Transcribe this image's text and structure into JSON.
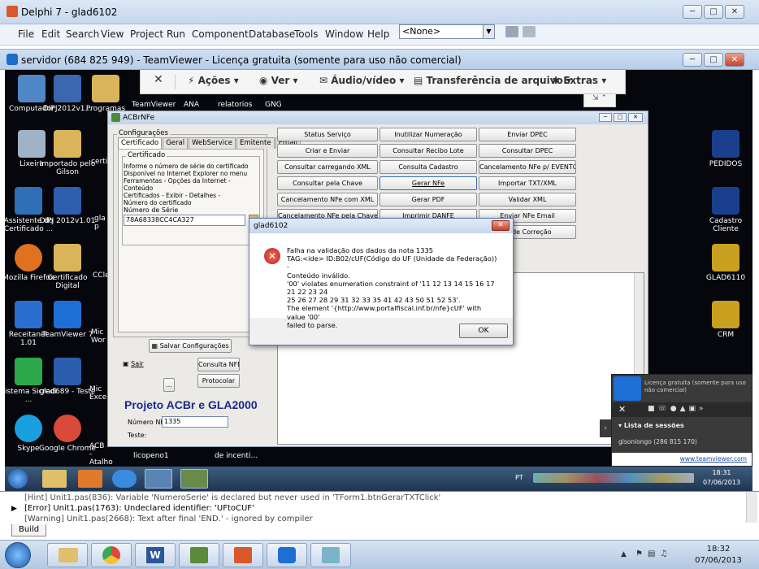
{
  "delphi": {
    "title": "Delphi 7 - glad6102",
    "menu": [
      "File",
      "Edit",
      "Search",
      "View",
      "Project",
      "Run",
      "Component",
      "Database",
      "Tools",
      "Window",
      "Help"
    ],
    "config_combo": "<None>"
  },
  "teamviewer": {
    "title": "servidor (684 825 949) - TeamViewer - Licença gratuita (somente para uso não comercial)",
    "toolbar": {
      "close_label": "✕",
      "acoes": "Ações",
      "ver": "Ver",
      "audio": "Áudio/vídeo",
      "transfer": "Transferência de arquivo",
      "extras": "Extras"
    },
    "panel": {
      "license": "Licença gratuita (somente para uso não comercial)",
      "sessions_header": "Lista de sessões",
      "session": "glsonlongo (286 815 170)",
      "link": "www.teamviewer.com"
    }
  },
  "desktop": {
    "left_icons": [
      {
        "label": "Computador",
        "color": "#4f86c6"
      },
      {
        "label": "Lixeira",
        "color": "#9fb3c8"
      },
      {
        "label": "Assistente do Certificado ...",
        "color": "#2f6fb5"
      },
      {
        "label": "Mozilla Firefox",
        "color": "#e0711f"
      },
      {
        "label": "Receitanet 1.01",
        "color": "#2a6fd0"
      },
      {
        "label": "Sistema Sicredi ...",
        "color": "#2aa84a"
      },
      {
        "label": "Skype",
        "color": "#1aa0e0"
      }
    ],
    "col2_icons": [
      {
        "label": "DIPJ2012v1...",
        "color": "#3b67b0"
      },
      {
        "label": "Importado pelo Gilson",
        "color": "#d9b45a"
      },
      {
        "label": "DIPJ 2012v1.01",
        "color": "#2d5fae"
      },
      {
        "label": "Certificado Digital",
        "color": "#d9b45a"
      },
      {
        "label": "TeamViewer 7",
        "color": "#1d6fd6"
      },
      {
        "label": "glad689 - Teste",
        "color": "#2b5dae"
      },
      {
        "label": "Google Chrome",
        "color": "#d94a3a"
      }
    ],
    "col3_labels": [
      "Programas",
      "certif",
      "gla p",
      "CCle",
      "Mic Wor",
      "Mic Excel",
      "ACB - Atalho"
    ],
    "top_row": [
      "TeamViewer",
      "ANA",
      "relatorios",
      "GNG"
    ],
    "bottom_row": [
      "licopeno1",
      "de incenti..."
    ],
    "right_icons": [
      {
        "label": "PEDIDOS",
        "color": "#1a3f8f"
      },
      {
        "label": "Cadastro Cliente",
        "color": "#1a3f8f"
      },
      {
        "label": "GLAD6110",
        "color": "#c9a020"
      },
      {
        "label": "CRM",
        "color": "#c9a020"
      }
    ]
  },
  "acbr": {
    "title": "ACBrNFe",
    "config_group": "Configurações",
    "tabs": [
      "Certificado",
      "Geral",
      "WebService",
      "Emitente",
      "Email"
    ],
    "cert_group": "Certificado",
    "cert_info": "Informe o número de série do certificado\nDisponível no Internet Explorer no menu\nFerramentas - Opções da Internet - Conteúdo\nCertificados - Exibir - Detalhes -\nNúmero do certificado",
    "serie_label": "Número de Série",
    "serie_value": "78A68338CC4CA327",
    "save_button": "Salvar Configurações",
    "sair_button": "Sair",
    "consulta_nfe": "Consulta NFE",
    "protocolar": "Protocolar",
    "ellipsis": "...",
    "project_title": "Projeto ACBr e GLA2000",
    "numero_label": "Número NF:",
    "numero_value": "1335",
    "teste_label": "Teste:",
    "buttons": [
      [
        "Status Serviço",
        "Inutilizar Numeração",
        "Enviar DPEC"
      ],
      [
        "Criar e Enviar",
        "Consultar Recibo Lote",
        "Consultar DPEC"
      ],
      [
        "Consultar carregando XML",
        "Consulta Cadastro",
        "Cancelamento NFe p/ EVENTO"
      ],
      [
        "Consultar pela Chave",
        "Gerar NFe",
        "Importar TXT/XML"
      ],
      [
        "Cancelamento NFe com XML",
        "Gerar PDF",
        "Validar XML"
      ],
      [
        "Cancelamento NFe pela Chave",
        "Imprimir DANFE",
        "Enviar NFe Email"
      ],
      [
        "",
        "",
        "ta de Correção"
      ]
    ]
  },
  "dialog": {
    "title": "glad6102",
    "message": "Falha na validação dos dados da nota 1335\nTAG:<ide> ID:B02/cUF(Código do UF (Unidade da Federação)) -\nConteúdo inválido.\n'00' violates enumeration constraint of '11 12 13 14 15 16 17 21 22 23 24\n25 26 27 28 29 31 32 33 35 41 42 43 50 51 52 53'.\nThe element '{http://www.portalfiscal.inf.br/nfe}cUF' with value '00'\nfailed to parse.",
    "ok": "OK"
  },
  "remote_taskbar": {
    "clock_time": "18:31",
    "clock_date": "07/06/2013",
    "lang": "PT"
  },
  "messages": {
    "lines": [
      "[Hint] Unit1.pas(836): Variable 'NumeroSerie' is declared but never used in 'TForm1.btnGerarTXTClick'",
      "[Error] Unit1.pas(1763): Undeclared identifier: 'UFtoCUF'",
      "[Warning] Unit1.pas(2668): Text after final 'END.' - ignored by compiler"
    ],
    "tab": "Build"
  },
  "taskbar": {
    "clock_time": "18:32",
    "clock_date": "07/06/2013"
  }
}
